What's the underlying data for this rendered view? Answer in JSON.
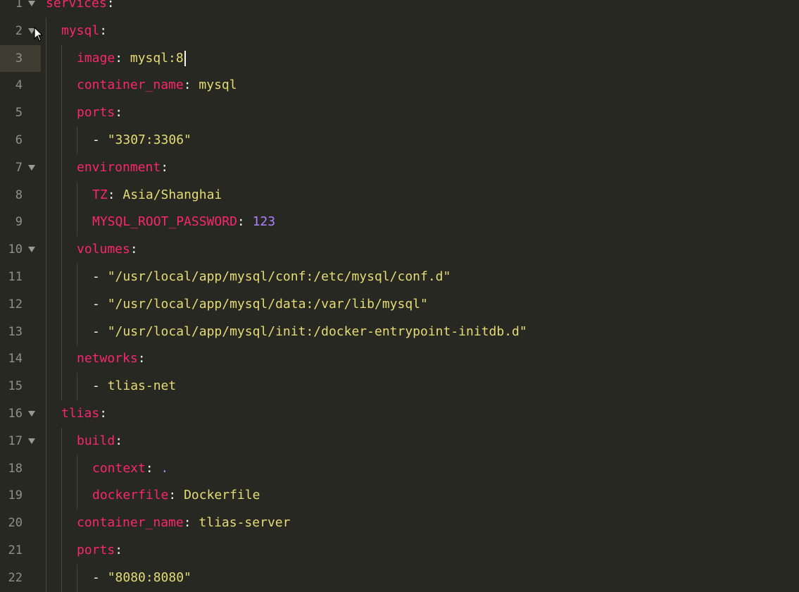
{
  "editor": {
    "active_line": 3,
    "lines": [
      {
        "n": "1",
        "fold": true,
        "indent": 0,
        "parts": [
          {
            "t": "services",
            "c": "key"
          },
          {
            "t": ":",
            "c": "punc"
          }
        ]
      },
      {
        "n": "2",
        "fold": true,
        "indent": 1,
        "parts": [
          {
            "t": "mysql",
            "c": "key"
          },
          {
            "t": ":",
            "c": "punc"
          }
        ]
      },
      {
        "n": "3",
        "fold": false,
        "indent": 2,
        "caret": true,
        "parts": [
          {
            "t": "image",
            "c": "key"
          },
          {
            "t": ": ",
            "c": "punc"
          },
          {
            "t": "mysql:8",
            "c": "val"
          }
        ]
      },
      {
        "n": "4",
        "fold": false,
        "indent": 2,
        "parts": [
          {
            "t": "container_name",
            "c": "key"
          },
          {
            "t": ": ",
            "c": "punc"
          },
          {
            "t": "mysql",
            "c": "val"
          }
        ]
      },
      {
        "n": "5",
        "fold": false,
        "indent": 2,
        "parts": [
          {
            "t": "ports",
            "c": "key"
          },
          {
            "t": ":",
            "c": "punc"
          }
        ]
      },
      {
        "n": "6",
        "fold": false,
        "indent": 3,
        "parts": [
          {
            "t": "- ",
            "c": "punc"
          },
          {
            "t": "\"3307:3306\"",
            "c": "val"
          }
        ]
      },
      {
        "n": "7",
        "fold": true,
        "indent": 2,
        "parts": [
          {
            "t": "environment",
            "c": "key"
          },
          {
            "t": ":",
            "c": "punc"
          }
        ]
      },
      {
        "n": "8",
        "fold": false,
        "indent": 3,
        "parts": [
          {
            "t": "TZ",
            "c": "key"
          },
          {
            "t": ": ",
            "c": "punc"
          },
          {
            "t": "Asia/Shanghai",
            "c": "val"
          }
        ]
      },
      {
        "n": "9",
        "fold": false,
        "indent": 3,
        "parts": [
          {
            "t": "MYSQL_ROOT_PASSWORD",
            "c": "key"
          },
          {
            "t": ": ",
            "c": "punc"
          },
          {
            "t": "123",
            "c": "num"
          }
        ]
      },
      {
        "n": "10",
        "fold": true,
        "indent": 2,
        "parts": [
          {
            "t": "volumes",
            "c": "key"
          },
          {
            "t": ":",
            "c": "punc"
          }
        ]
      },
      {
        "n": "11",
        "fold": false,
        "indent": 3,
        "parts": [
          {
            "t": "- ",
            "c": "punc"
          },
          {
            "t": "\"/usr/local/app/mysql/conf:/etc/mysql/conf.d\"",
            "c": "val"
          }
        ]
      },
      {
        "n": "12",
        "fold": false,
        "indent": 3,
        "parts": [
          {
            "t": "- ",
            "c": "punc"
          },
          {
            "t": "\"/usr/local/app/mysql/data:/var/lib/mysql\"",
            "c": "val"
          }
        ]
      },
      {
        "n": "13",
        "fold": false,
        "indent": 3,
        "parts": [
          {
            "t": "- ",
            "c": "punc"
          },
          {
            "t": "\"/usr/local/app/mysql/init:/docker-entrypoint-initdb.d\"",
            "c": "val"
          }
        ]
      },
      {
        "n": "14",
        "fold": false,
        "indent": 2,
        "parts": [
          {
            "t": "networks",
            "c": "key"
          },
          {
            "t": ":",
            "c": "punc"
          }
        ]
      },
      {
        "n": "15",
        "fold": false,
        "indent": 3,
        "parts": [
          {
            "t": "- ",
            "c": "punc"
          },
          {
            "t": "tlias-net",
            "c": "val"
          }
        ]
      },
      {
        "n": "16",
        "fold": true,
        "indent": 1,
        "parts": [
          {
            "t": "tlias",
            "c": "key"
          },
          {
            "t": ":",
            "c": "punc"
          }
        ]
      },
      {
        "n": "17",
        "fold": true,
        "indent": 2,
        "parts": [
          {
            "t": "build",
            "c": "key"
          },
          {
            "t": ":",
            "c": "punc"
          }
        ]
      },
      {
        "n": "18",
        "fold": false,
        "indent": 3,
        "parts": [
          {
            "t": "context",
            "c": "key"
          },
          {
            "t": ": ",
            "c": "punc"
          },
          {
            "t": ".",
            "c": "dot"
          }
        ]
      },
      {
        "n": "19",
        "fold": false,
        "indent": 3,
        "parts": [
          {
            "t": "dockerfile",
            "c": "key"
          },
          {
            "t": ": ",
            "c": "punc"
          },
          {
            "t": "Dockerfile",
            "c": "val"
          }
        ]
      },
      {
        "n": "20",
        "fold": false,
        "indent": 2,
        "parts": [
          {
            "t": "container_name",
            "c": "key"
          },
          {
            "t": ": ",
            "c": "punc"
          },
          {
            "t": "tlias-server",
            "c": "val"
          }
        ]
      },
      {
        "n": "21",
        "fold": false,
        "indent": 2,
        "parts": [
          {
            "t": "ports",
            "c": "key"
          },
          {
            "t": ":",
            "c": "punc"
          }
        ]
      },
      {
        "n": "22",
        "fold": false,
        "indent": 3,
        "parts": [
          {
            "t": "- ",
            "c": "punc"
          },
          {
            "t": "\"8080:8080\"",
            "c": "val"
          }
        ]
      }
    ]
  },
  "colors": {
    "background": "#272822",
    "key": "#f92672",
    "string": "#e6db74",
    "number": "#ae81ff",
    "gutter_text": "#90908a",
    "active_gutter": "#3e3d32"
  }
}
